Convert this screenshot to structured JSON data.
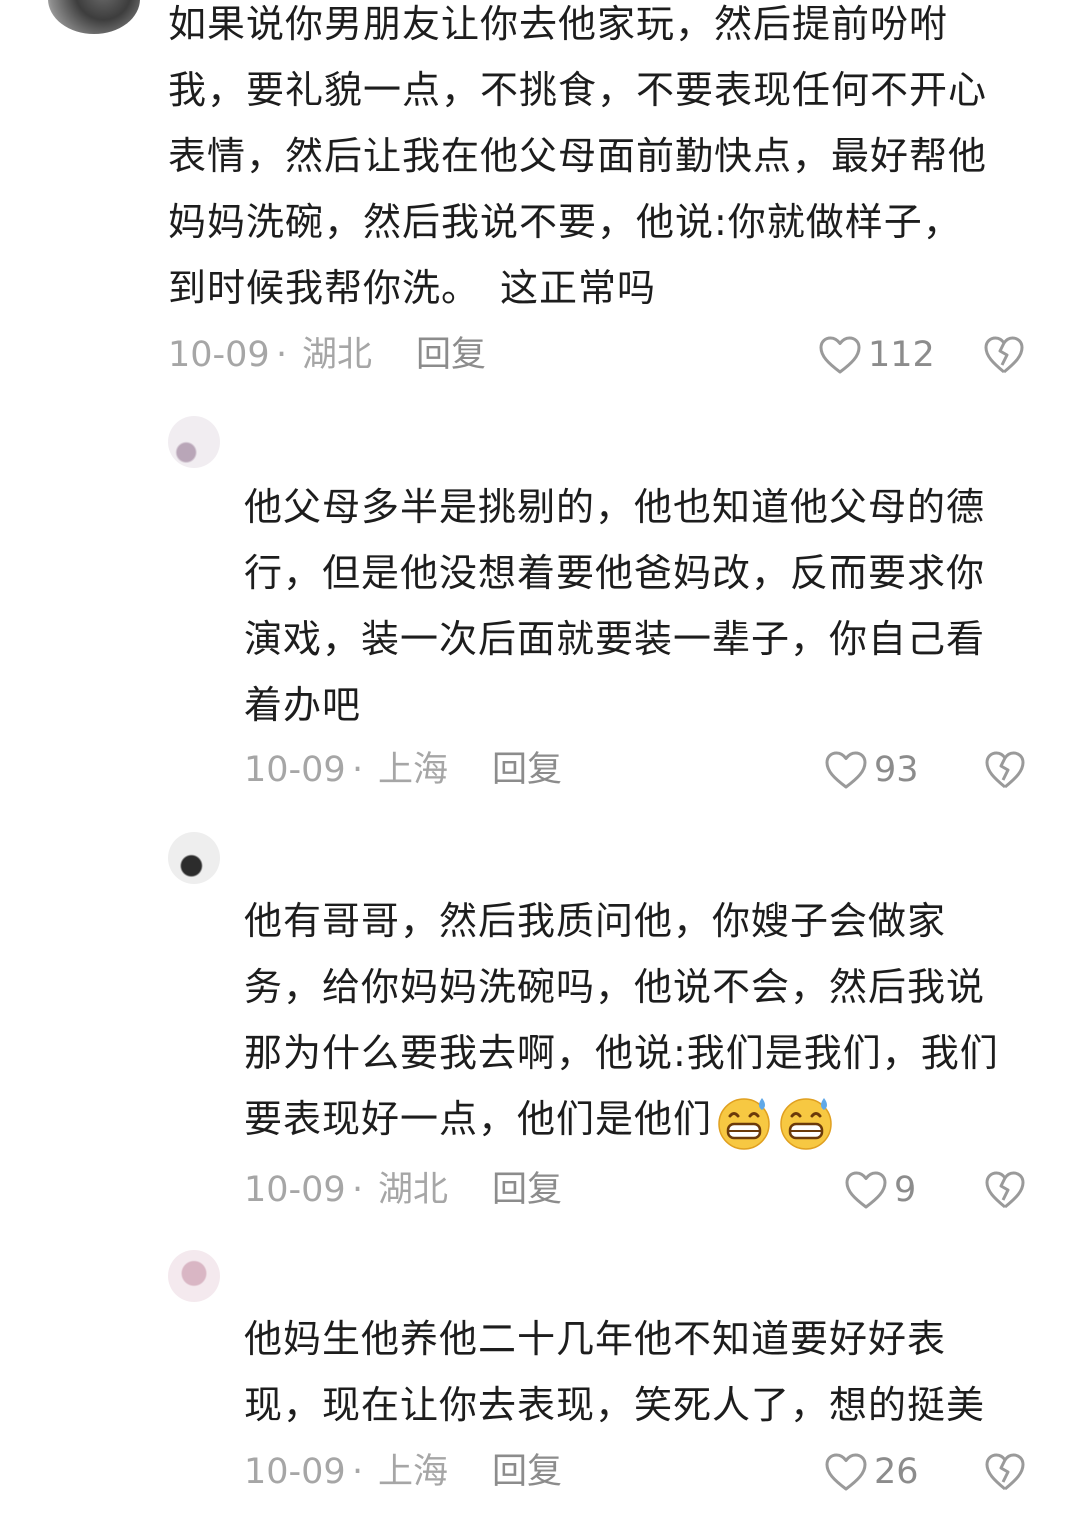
{
  "comments": [
    {
      "lines": [
        "如果说你男朋友让你去他家玩，然后提前吩咐",
        "我，要礼貌一点，不挑食，不要表现任何不开心",
        "表情，然后让我在他父母面前勤快点，最好帮他",
        "妈妈洗碗，然后我说不要，他说:你就做样子，",
        "到时候我帮你洗。　这正常吗"
      ],
      "date": "10-09",
      "location": "湖北",
      "reply_label": "回复",
      "likes": "112"
    },
    {
      "lines": [
        "他父母多半是挑剔的，他也知道他父母的德",
        "行，但是他没想着要他爸妈改，反而要求你",
        "演戏，装一次后面就要装一辈子，你自己看",
        "着办吧"
      ],
      "date": "10-09",
      "location": "上海",
      "reply_label": "回复",
      "likes": "93"
    },
    {
      "lines": [
        "他有哥哥，然后我质问他，你嫂子会做家",
        "务，给你妈妈洗碗吗，他说不会，然后我说",
        "那为什么要我去啊，他说:我们是我们，我们",
        "要表现好一点，他们是他们"
      ],
      "date": "10-09",
      "location": "湖北",
      "reply_label": "回复",
      "likes": "9"
    },
    {
      "lines": [
        "他妈生他养他二十几年他不知道要好好表",
        "现，现在让你去表现，笑死人了，想的挺美"
      ],
      "date": "10-09",
      "location": "上海",
      "reply_label": "回复",
      "likes": "26"
    }
  ],
  "separator": "·",
  "icons": {
    "like": "heart-outline-icon",
    "dislike": "broken-heart-icon",
    "emoji": "grinning-sweat-emoji"
  }
}
